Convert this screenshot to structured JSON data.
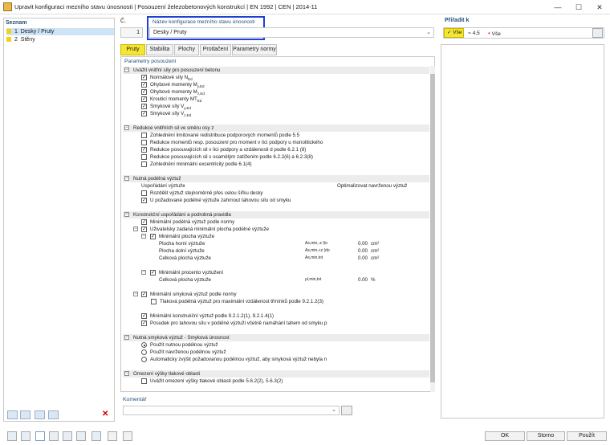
{
  "window": {
    "title": "Upravit konfiguraci mezního stavu únosnosti | Posouzení železobetonových konstrukcí | EN 1992 | CEN | 2014-11",
    "minimize": "—",
    "maximize": "☐",
    "close": "✕"
  },
  "list": {
    "header": "Seznam",
    "items": [
      {
        "num": "1",
        "label": "Desky / Pruty"
      },
      {
        "num": "2",
        "label": "Stěny"
      }
    ]
  },
  "config": {
    "no_label": "Č.",
    "no_value": "1",
    "name_label": "Název konfigurace mezního stavu únosnosti",
    "name_value": "Desky / Pruty"
  },
  "applied": {
    "label": "Přiřadit k",
    "all_btn": "Vše",
    "count": "4,5",
    "all2": "Vše"
  },
  "tabs": [
    "Pruty",
    "Stabilita",
    "Plochy",
    "Protlačení",
    "Parametry normy"
  ],
  "params_header": "Parametry posouzení",
  "sections": {
    "s1": "Uvážit vnitřní síly pro posouzení betonu",
    "s2": "Redukce vnitřních sil ve směru osy z",
    "s3": "Nutná podélná výztuž",
    "s4": "Konstrukční uspořádání a podrobná pravidla",
    "s5": "Nutná smyková výztuž - Smyková únosnost",
    "s6": "Omezení výšky tlakové oblasti"
  },
  "s1items": [
    "Normálové síly N",
    "Ohybové momenty M",
    "Ohybové momenty M",
    "Krouticí momenty MT",
    "Smykové síly V",
    "Smykové síly V"
  ],
  "s1subs": [
    "Ed",
    "y,Ed",
    "z,Ed",
    "Ed",
    "y,Ed",
    "z,Ed"
  ],
  "s2items": [
    "Zohlednění limitované redistribuce podporových momentů podle 5.5",
    "Redukce momentů resp. posouzení pro moment v líci podpory u monolitického",
    "Redukce posouvajících sil v líci podpory a vzdálenosti d podle 6.2.1 (8)",
    "Redukce posouvajících sil s osamělým zatížením podle 6.2.2(6) a 6.2.3(8)",
    "Zohlednění minimální excentricity podle 6.1(4)"
  ],
  "s3": {
    "col1": "Uspořádání výztuže",
    "col2": "Optimalizovat navrženou výztuž",
    "items": [
      "Rozdělit výztuž stejnoměrně přes celou šířku desky",
      "U požadované podélné výztuže zahrnout tahovou sílu od smyku"
    ]
  },
  "s4": {
    "min_long": "Minimální podélná výztuž podle normy",
    "user_min": "Uživatelsky zadaná minimální plocha podélné výztuže",
    "min_area": "Minimální plocha výztuže",
    "top": "Plocha horní výztuže",
    "top_sym": "As,min,-z (to",
    "top_val": "0.00",
    "top_unit": "cm²",
    "bot": "Plocha dolní výztuže",
    "bot_sym": "As,min,+z (do",
    "bot_val": "0.00",
    "bot_unit": "cm²",
    "tot": "Celková plocha výztuže",
    "tot_sym": "As,min,tot",
    "tot_val": "0.00",
    "tot_unit": "cm²",
    "min_pct": "Minimální procento vyztužení",
    "tot2": "Celková plocha výztuže",
    "tot2_sym": "ρl,min,tot",
    "tot2_val": "0.00",
    "tot2_unit": "%",
    "min_shear": "Minimální smyková výztuž podle normy",
    "comp_long": "Tlaková podélná výztuž pro maximální vzdálenost třmínků podle 9.2.1.2(3)",
    "constr_min": "Minimální konstrukční výztuž podle 9.2.1.2(1), 9.2.1.4(1)",
    "tension": "Posudek pro tahovou sílu v podélné výztuži včetně namáhání tahem od smyku p"
  },
  "s5items": [
    "Použít nutnou podélnou výztuž",
    "Použít navrženou podélnou výztuž",
    "Automaticky zvýšit požadovanou podélnou výztuž, aby smyková výztuž nebyla n"
  ],
  "s6items": [
    "Uvážit omezení výšky tlakové oblasti podle 5.6.2(2), 5.6.3(2)"
  ],
  "comment_label": "Komentář",
  "footer": {
    "ok": "OK",
    "cancel": "Storno",
    "apply": "Použít"
  },
  "colors": {
    "accent": "#f5e632",
    "focus": "#1f3fd6",
    "header": "#1f4e79"
  }
}
